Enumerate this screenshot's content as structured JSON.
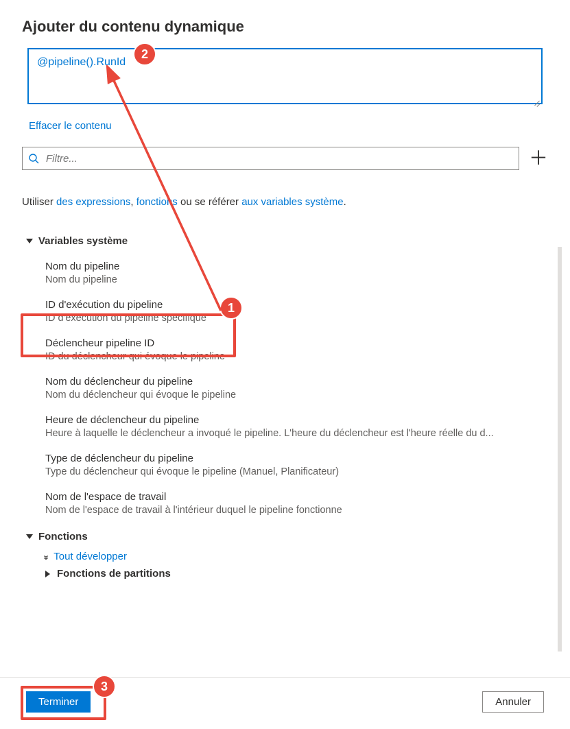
{
  "title": "Ajouter du contenu dynamique",
  "expression_value": "@pipeline().RunId",
  "clear_label": "Effacer le contenu",
  "filter_placeholder": "Filtre...",
  "help": {
    "prefix": "Utiliser ",
    "link1": "des expressions",
    "sep1": ", ",
    "link2": "fonctions",
    "mid": " ou se référer ",
    "link3": "aux variables système",
    "suffix": "."
  },
  "sections": {
    "sysvars": {
      "label": "Variables système",
      "items": [
        {
          "title": "Nom du pipeline",
          "desc": "Nom du pipeline"
        },
        {
          "title": "ID d'exécution du pipeline",
          "desc": "ID d'exécution du pipeline spécifique"
        },
        {
          "title": "Déclencheur pipeline ID",
          "desc": "ID du déclencheur qui évoque le pipeline"
        },
        {
          "title": "Nom du déclencheur du pipeline",
          "desc": "Nom du déclencheur qui évoque le pipeline"
        },
        {
          "title": "Heure de déclencheur du pipeline",
          "desc": "Heure à laquelle le déclencheur a invoqué le pipeline. L'heure du déclencheur est l'heure réelle du d..."
        },
        {
          "title": "Type de déclencheur du pipeline",
          "desc": "Type du déclencheur qui évoque le pipeline (Manuel, Planificateur)"
        },
        {
          "title": "Nom de l'espace de travail",
          "desc": "Nom de l'espace de travail à l'intérieur duquel le pipeline fonctionne"
        }
      ]
    },
    "functions": {
      "label": "Fonctions",
      "expand_all": "Tout développer",
      "sub": "Fonctions de partitions"
    }
  },
  "footer": {
    "finish": "Terminer",
    "cancel": "Annuler"
  },
  "annotations": {
    "n1": "1",
    "n2": "2",
    "n3": "3"
  }
}
